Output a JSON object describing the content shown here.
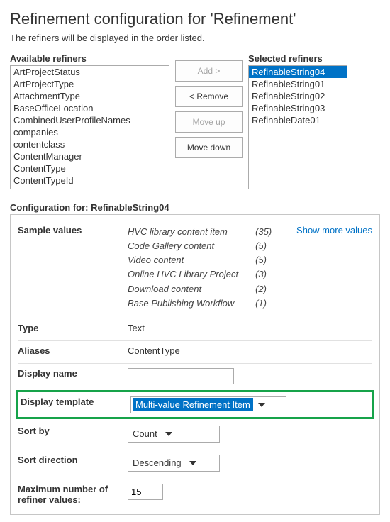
{
  "header": {
    "title": "Refinement configuration for 'Refinement'",
    "subtitle": "The refiners will be displayed in the order listed."
  },
  "available": {
    "label": "Available refiners",
    "items": [
      "ArtProjectStatus",
      "ArtProjectType",
      "AttachmentType",
      "BaseOfficeLocation",
      "CombinedUserProfileNames",
      "companies",
      "contentclass",
      "ContentManager",
      "ContentType",
      "ContentTypeId"
    ]
  },
  "selected": {
    "label": "Selected refiners",
    "items": [
      "RefinableString04",
      "RefinableString01",
      "RefinableString02",
      "RefinableString03",
      "RefinableDate01"
    ],
    "selectedIndex": 0
  },
  "buttons": {
    "add": "Add >",
    "remove": "< Remove",
    "moveUp": "Move up",
    "moveDown": "Move down"
  },
  "config": {
    "heading": "Configuration for: RefinableString04",
    "sampleLabel": "Sample values",
    "samples": [
      {
        "name": "HVC library content item",
        "count": "(35)"
      },
      {
        "name": "Code Gallery content",
        "count": "(5)"
      },
      {
        "name": "Video content",
        "count": "(5)"
      },
      {
        "name": "Online HVC Library Project",
        "count": "(3)"
      },
      {
        "name": "Download content",
        "count": "(2)"
      },
      {
        "name": "Base Publishing Workflow",
        "count": "(1)"
      }
    ],
    "showMore": "Show more values",
    "typeLabel": "Type",
    "typeValue": "Text",
    "aliasesLabel": "Aliases",
    "aliasesValue": "ContentType",
    "displayNameLabel": "Display name",
    "displayNameValue": "",
    "displayTemplateLabel": "Display template",
    "displayTemplateValue": "Multi-value Refinement Item",
    "sortByLabel": "Sort by",
    "sortByValue": "Count",
    "sortDirectionLabel": "Sort direction",
    "sortDirectionValue": "Descending",
    "maxLabel": "Maximum number of refiner values:",
    "maxValue": "15"
  }
}
